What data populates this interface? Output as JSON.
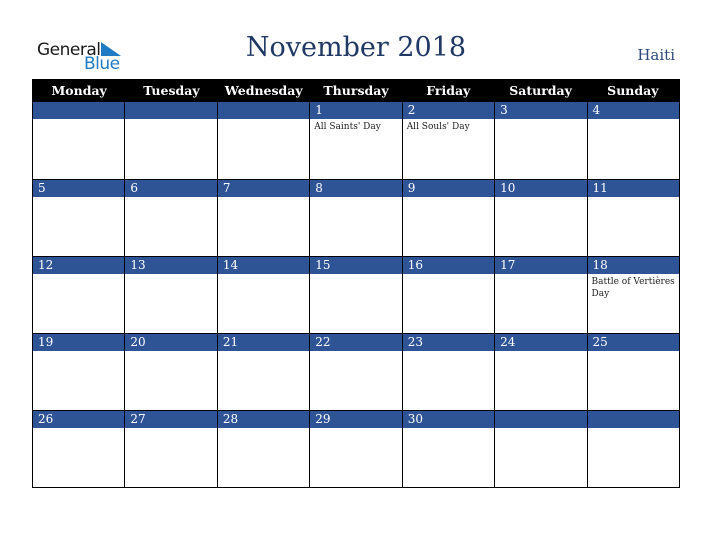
{
  "logo": {
    "line1": "General",
    "line2": "Blue"
  },
  "title": "November 2018",
  "country": "Haiti",
  "colors": {
    "header_bg": "#000000",
    "day_bar": "#2f5496",
    "title": "#1f3864",
    "logo_blue": "#1e7bc4"
  },
  "weekdays": [
    "Monday",
    "Tuesday",
    "Wednesday",
    "Thursday",
    "Friday",
    "Saturday",
    "Sunday"
  ],
  "weeks": [
    [
      {
        "day": "",
        "event": ""
      },
      {
        "day": "",
        "event": ""
      },
      {
        "day": "",
        "event": ""
      },
      {
        "day": "1",
        "event": "All Saints' Day"
      },
      {
        "day": "2",
        "event": "All Souls' Day"
      },
      {
        "day": "3",
        "event": ""
      },
      {
        "day": "4",
        "event": ""
      }
    ],
    [
      {
        "day": "5",
        "event": ""
      },
      {
        "day": "6",
        "event": ""
      },
      {
        "day": "7",
        "event": ""
      },
      {
        "day": "8",
        "event": ""
      },
      {
        "day": "9",
        "event": ""
      },
      {
        "day": "10",
        "event": ""
      },
      {
        "day": "11",
        "event": ""
      }
    ],
    [
      {
        "day": "12",
        "event": ""
      },
      {
        "day": "13",
        "event": ""
      },
      {
        "day": "14",
        "event": ""
      },
      {
        "day": "15",
        "event": ""
      },
      {
        "day": "16",
        "event": ""
      },
      {
        "day": "17",
        "event": ""
      },
      {
        "day": "18",
        "event": "Battle of Vertières Day"
      }
    ],
    [
      {
        "day": "19",
        "event": ""
      },
      {
        "day": "20",
        "event": ""
      },
      {
        "day": "21",
        "event": ""
      },
      {
        "day": "22",
        "event": ""
      },
      {
        "day": "23",
        "event": ""
      },
      {
        "day": "24",
        "event": ""
      },
      {
        "day": "25",
        "event": ""
      }
    ],
    [
      {
        "day": "26",
        "event": ""
      },
      {
        "day": "27",
        "event": ""
      },
      {
        "day": "28",
        "event": ""
      },
      {
        "day": "29",
        "event": ""
      },
      {
        "day": "30",
        "event": ""
      },
      {
        "day": "",
        "event": ""
      },
      {
        "day": "",
        "event": ""
      }
    ]
  ]
}
